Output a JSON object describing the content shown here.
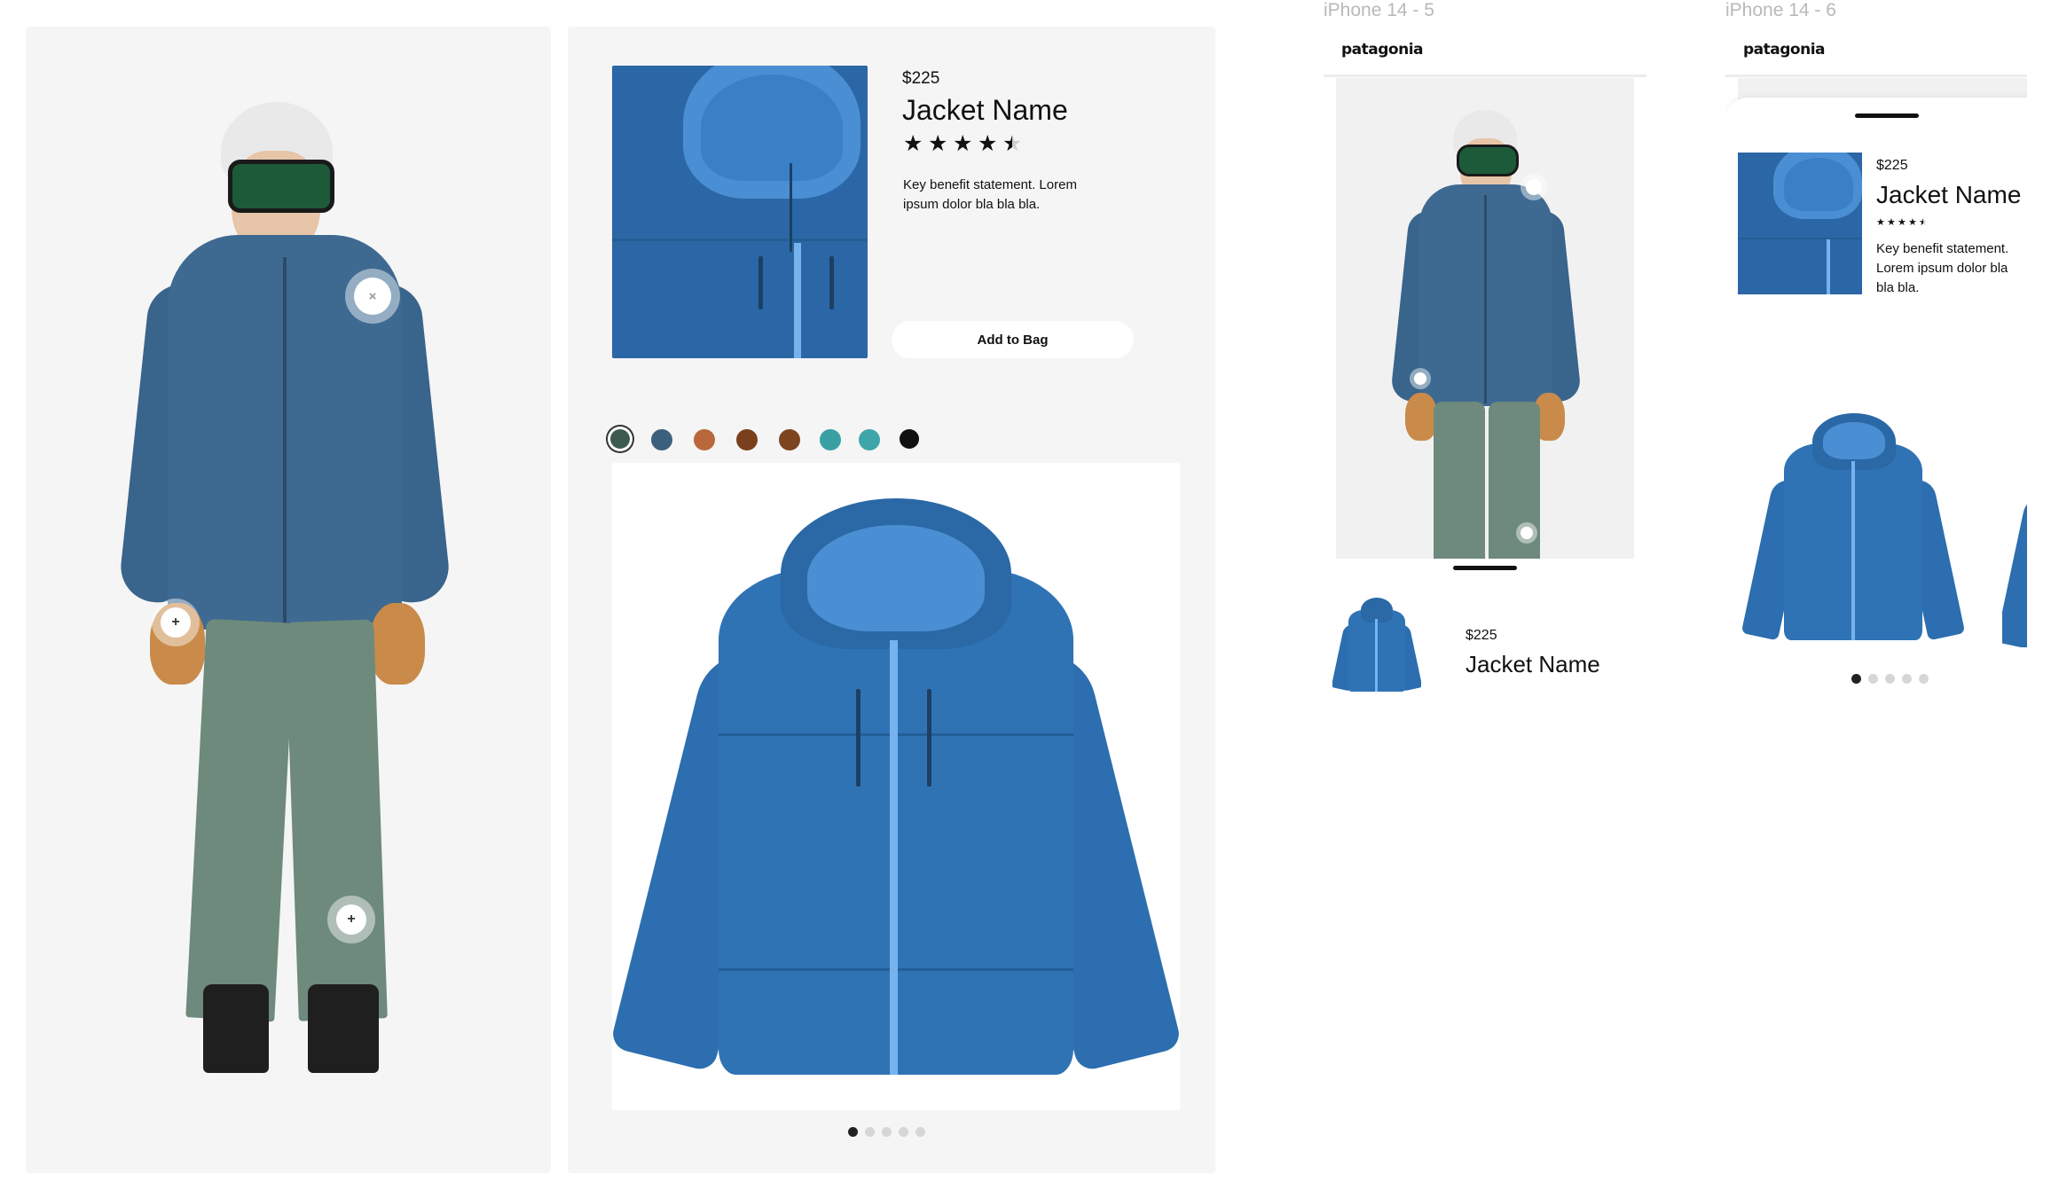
{
  "colors": {
    "panel_bg": "#f5f5f5",
    "jacket_blue": "#2f73b5",
    "jacket_navy": "#3e6a92",
    "pants_green": "#6d8a7c"
  },
  "desktop": {
    "hotspots": [
      {
        "symbol": "×",
        "icon": "close-icon"
      },
      {
        "symbol": "+",
        "icon": "plus-icon"
      },
      {
        "symbol": "+",
        "icon": "plus-icon"
      }
    ],
    "product": {
      "price": "$225",
      "name": "Jacket Name",
      "rating": 4.5,
      "stars": [
        "★",
        "★",
        "★",
        "★",
        "★"
      ],
      "description": "Key benefit statement. Lorem ipsum dolor bla bla bla.",
      "add_to_bag_label": "Add to Bag"
    },
    "swatches": [
      "#3d5a4f",
      "#3d5f7e",
      "#b8683a",
      "#7a3f1c",
      "#7d4420",
      "#3aa0a3",
      "#3ea6a8",
      "#111111"
    ],
    "carousel": {
      "count": 5,
      "active": 0
    }
  },
  "mobile5": {
    "frame_label": "iPhone 14 - 5",
    "brand": "patagonia",
    "price": "$225",
    "name": "Jacket Name"
  },
  "mobile6": {
    "frame_label": "iPhone 14 - 6",
    "brand": "patagonia",
    "price": "$225",
    "name": "Jacket Name",
    "rating": 4.5,
    "stars": [
      "★",
      "★",
      "★",
      "★",
      "★"
    ],
    "description": "Key benefit statement. Lorem ipsum dolor bla bla bla.",
    "carousel": {
      "count": 5,
      "active": 0
    }
  }
}
